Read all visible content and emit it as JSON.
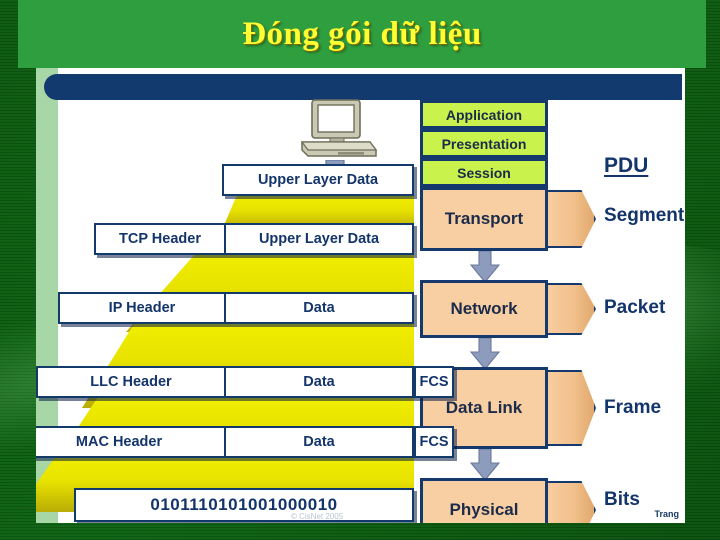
{
  "slide": {
    "title": "Đóng gói dữ liệu",
    "title_color": "#ffff33",
    "banner_color": "#2f9e3f",
    "background_color": "#0a5c0a",
    "canvas_color": "#ffffff",
    "accent_navy": "#133a6e"
  },
  "diagram": {
    "source_device": "desktop-computer",
    "copyright": "© CisNet 2005",
    "page_label": "Trang",
    "encapsulation_rows": [
      {
        "id": "upper-layer-data",
        "cells": [
          {
            "text": "Upper Layer Data"
          }
        ],
        "fcs": null
      },
      {
        "id": "transport-segment",
        "cells": [
          {
            "text": "TCP Header"
          },
          {
            "text": "Upper Layer Data"
          }
        ],
        "fcs": null
      },
      {
        "id": "network-packet",
        "cells": [
          {
            "text": "IP Header"
          },
          {
            "text": "Data"
          }
        ],
        "fcs": null
      },
      {
        "id": "llc-frame",
        "cells": [
          {
            "text": "LLC Header"
          },
          {
            "text": "Data"
          }
        ],
        "fcs": "FCS"
      },
      {
        "id": "mac-frame",
        "cells": [
          {
            "text": "MAC Header"
          },
          {
            "text": "Data"
          }
        ],
        "fcs": "FCS"
      },
      {
        "id": "physical-bits",
        "cells": [
          {
            "text": "0101110101001000010"
          }
        ],
        "fcs": null
      }
    ],
    "osi_layers": [
      {
        "name": "Application",
        "tier": "upper",
        "color": "#c9f24d"
      },
      {
        "name": "Presentation",
        "tier": "upper",
        "color": "#c9f24d"
      },
      {
        "name": "Session",
        "tier": "upper",
        "color": "#c9f24d"
      },
      {
        "name": "Transport",
        "tier": "lower",
        "color": "#f8cfa3"
      },
      {
        "name": "Network",
        "tier": "lower",
        "color": "#f8cfa3"
      },
      {
        "name": "Data Link",
        "tier": "lower",
        "color": "#f8cfa3"
      },
      {
        "name": "Physical",
        "tier": "lower",
        "color": "#f8cfa3"
      }
    ],
    "pdu": {
      "heading": "PDU",
      "entries": [
        {
          "label": "Segment",
          "layer": "Transport"
        },
        {
          "label": "Packet",
          "layer": "Network"
        },
        {
          "label": "Frame",
          "layer": "Data Link"
        },
        {
          "label": "Bits",
          "layer": "Physical"
        }
      ]
    }
  }
}
